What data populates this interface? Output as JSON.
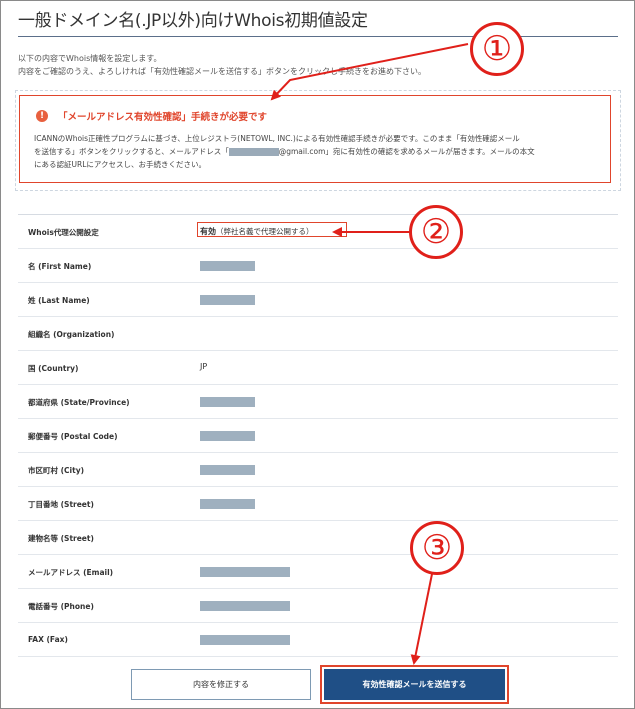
{
  "page": {
    "title": "一般ドメイン名(.JP以外)向けWhois初期値設定",
    "intro_line1": "以下の内容でWhois情報を設定します。",
    "intro_line2": "内容をご確認のうえ、よろしければ「有効性確認メールを送信する」ボタンをクリックし手続きをお進め下さい。"
  },
  "alert": {
    "icon": "exclamation-icon",
    "title": "「メールアドレス有効性確認」手続きが必要です",
    "body_line1": "ICANNのWhois正確性プログラムに基づき、上位レジストラ(NETOWL, INC.)による有効性確認手続きが必要です。このまま「有効性確認メール",
    "body_line2a": "を送信する」ボタンをクリックすると、メールアドレス「",
    "body_line2b": "@gmail.com」宛に有効性の確認を求めるメールが届きます。メールの本文",
    "body_line3": "にある認証URLにアクセスし、お手続きください。"
  },
  "table": {
    "rows": [
      {
        "label": "Whois代理公開設定",
        "value": "有効",
        "note": "（弊社名義で代理公開する）"
      },
      {
        "label": "名 (First Name)",
        "value": ""
      },
      {
        "label": "姓 (Last Name)",
        "value": ""
      },
      {
        "label": "組織名 (Organization)",
        "value": ""
      },
      {
        "label": "国 (Country)",
        "value": "JP"
      },
      {
        "label": "都道府県 (State/Province)",
        "value": ""
      },
      {
        "label": "郵便番号 (Postal Code)",
        "value": ""
      },
      {
        "label": "市区町村 (City)",
        "value": ""
      },
      {
        "label": "丁目番地 (Street)",
        "value": ""
      },
      {
        "label": "建物名等 (Street)",
        "value": ""
      },
      {
        "label": "メールアドレス (Email)",
        "value": ""
      },
      {
        "label": "電話番号 (Phone)",
        "value": ""
      },
      {
        "label": "FAX (Fax)",
        "value": ""
      }
    ]
  },
  "buttons": {
    "edit_label": "内容を修正する",
    "send_label": "有効性確認メールを送信する"
  },
  "callouts": [
    "①",
    "②",
    "③"
  ],
  "colors": {
    "accent_red": "#e0452c",
    "primary_blue": "#1f4f86",
    "redaction": "#9fb0bf"
  }
}
